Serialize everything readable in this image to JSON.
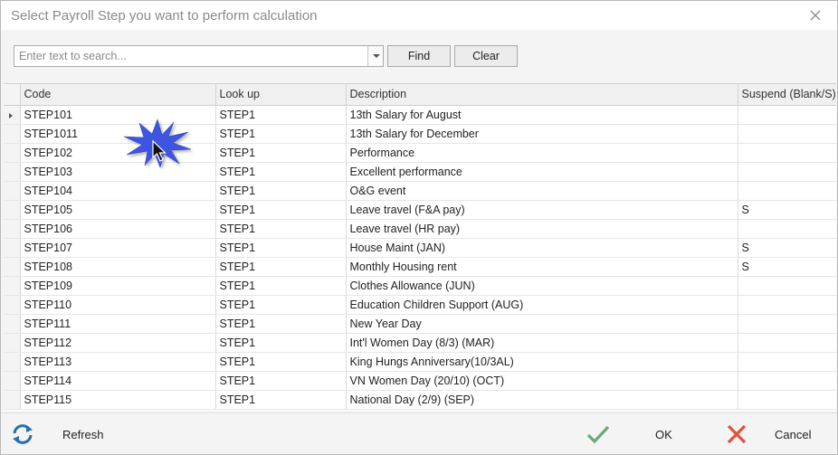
{
  "window": {
    "title": "Select Payroll Step you want to perform calculation"
  },
  "search": {
    "placeholder": "Enter text to search...",
    "value": ""
  },
  "toolbar": {
    "find_label": "Find",
    "clear_label": "Clear"
  },
  "grid": {
    "columns": [
      "Code",
      "Look up",
      "Description",
      "Suspend (Blank/S)"
    ],
    "rows": [
      {
        "code": "STEP101",
        "lookup": "STEP1",
        "description": "13th Salary for August",
        "suspend": ""
      },
      {
        "code": "STEP1011",
        "lookup": "STEP1",
        "description": "13th Salary for December",
        "suspend": ""
      },
      {
        "code": "STEP102",
        "lookup": "STEP1",
        "description": "Performance",
        "suspend": ""
      },
      {
        "code": "STEP103",
        "lookup": "STEP1",
        "description": "Excellent performance",
        "suspend": ""
      },
      {
        "code": "STEP104",
        "lookup": "STEP1",
        "description": "O&G event",
        "suspend": ""
      },
      {
        "code": "STEP105",
        "lookup": "STEP1",
        "description": "Leave travel (F&A pay)",
        "suspend": "S"
      },
      {
        "code": "STEP106",
        "lookup": "STEP1",
        "description": "Leave travel (HR pay)",
        "suspend": ""
      },
      {
        "code": "STEP107",
        "lookup": "STEP1",
        "description": "House Maint (JAN)",
        "suspend": "S"
      },
      {
        "code": "STEP108",
        "lookup": "STEP1",
        "description": "Monthly Housing rent",
        "suspend": "S"
      },
      {
        "code": "STEP109",
        "lookup": "STEP1",
        "description": "Clothes Allowance (JUN)",
        "suspend": ""
      },
      {
        "code": "STEP110",
        "lookup": "STEP1",
        "description": "Education Children Support (AUG)",
        "suspend": ""
      },
      {
        "code": "STEP111",
        "lookup": "STEP1",
        "description": "New Year Day",
        "suspend": ""
      },
      {
        "code": "STEP112",
        "lookup": "STEP1",
        "description": "Int'l Women Day (8/3) (MAR)",
        "suspend": ""
      },
      {
        "code": "STEP113",
        "lookup": "STEP1",
        "description": "King Hungs Anniversary(10/3AL)",
        "suspend": ""
      },
      {
        "code": "STEP114",
        "lookup": "STEP1",
        "description": "VN Women Day (20/10) (OCT)",
        "suspend": ""
      },
      {
        "code": "STEP115",
        "lookup": "STEP1",
        "description": "National Day (2/9) (SEP)",
        "suspend": ""
      }
    ]
  },
  "footer": {
    "refresh_label": "Refresh",
    "ok_label": "OK",
    "cancel_label": "Cancel"
  },
  "colors": {
    "refresh_icon": "#2a6fb0",
    "ok_icon": "#6aa87a",
    "cancel_icon": "#e0533c",
    "starburst": "#3d55e0"
  }
}
